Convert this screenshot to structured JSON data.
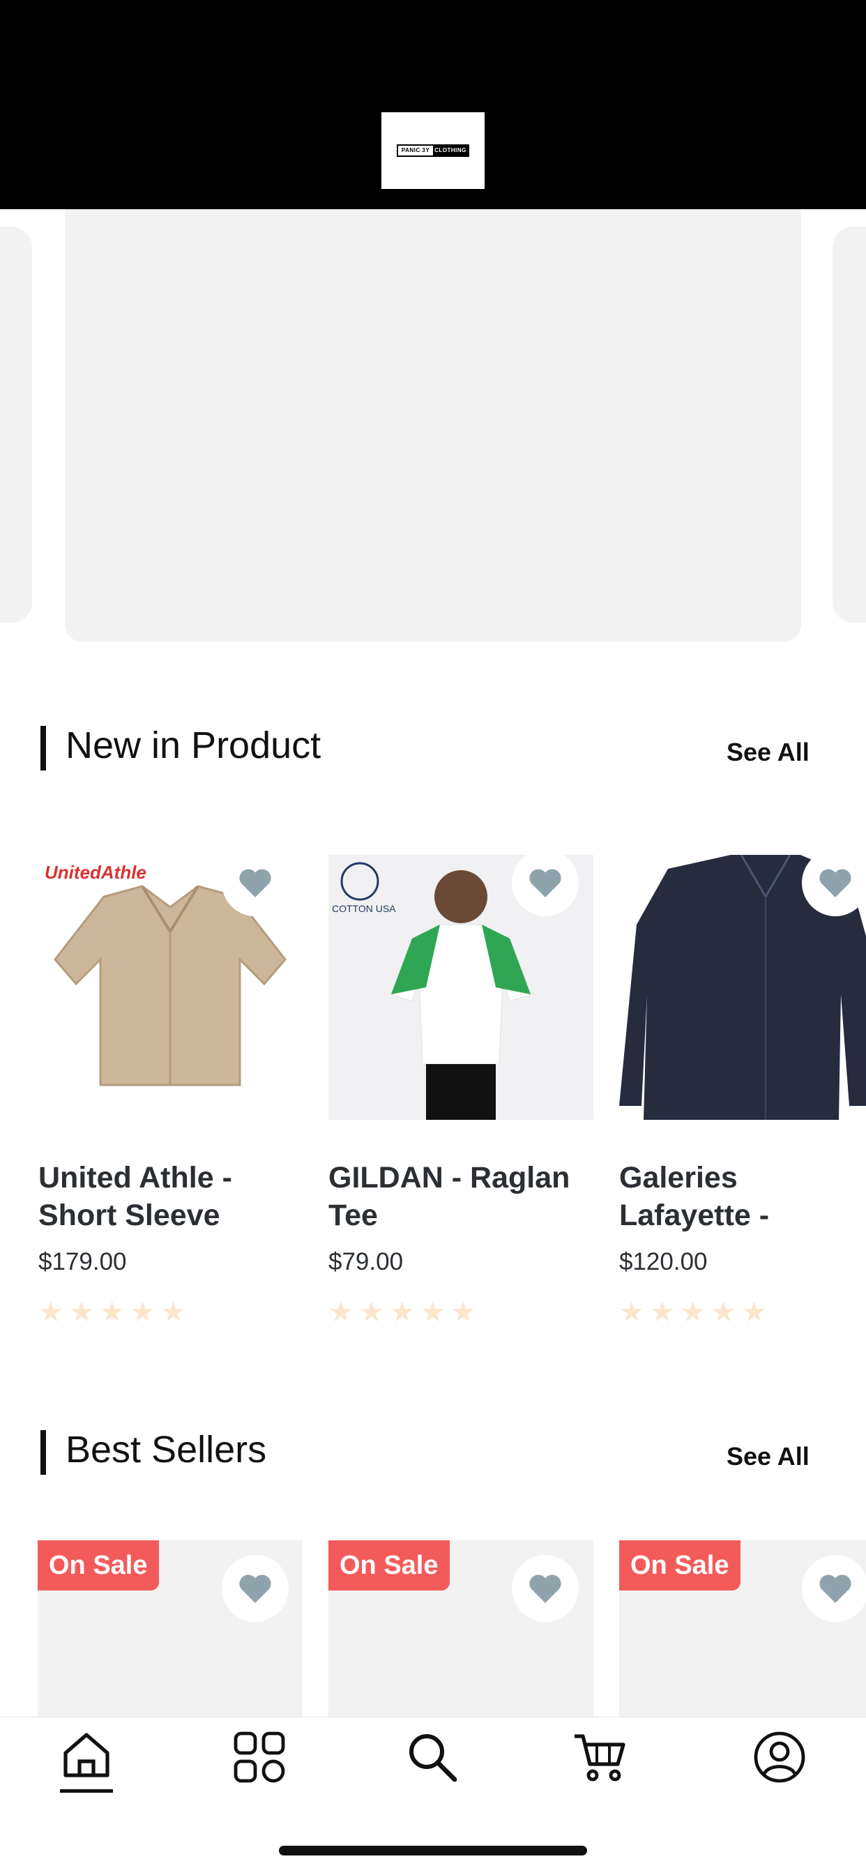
{
  "header": {
    "logo_text_left": "PANIC 3Y",
    "logo_text_right": "CLOTHING"
  },
  "sections": {
    "new": {
      "title": "New in Product",
      "see_all": "See All"
    },
    "best": {
      "title": "Best Sellers",
      "see_all": "See All"
    }
  },
  "products": [
    {
      "name": "United Athle - Short Sleeve",
      "price": "$179.00",
      "brand_tag": "UnitedAthle",
      "rating": 0
    },
    {
      "name": "GILDAN - Raglan Tee",
      "price": "$79.00",
      "brand_tag": "COTTON USA",
      "rating": 0
    },
    {
      "name": "Galeries Lafayette -",
      "price": "$120.00",
      "rating": 0
    }
  ],
  "best_sellers": [
    {
      "badge": "On Sale"
    },
    {
      "badge": "On Sale"
    },
    {
      "badge": "On Sale"
    }
  ],
  "nav": {
    "items": [
      {
        "icon": "home-icon",
        "active": true
      },
      {
        "icon": "categories-icon",
        "active": false
      },
      {
        "icon": "search-icon",
        "active": false
      },
      {
        "icon": "cart-icon",
        "active": false
      },
      {
        "icon": "profile-icon",
        "active": false
      }
    ]
  },
  "colors": {
    "sale": "#f35b5b",
    "heart": "#8fa3ad",
    "star": "#fde5cc",
    "placeholder": "#f2f2f2"
  }
}
